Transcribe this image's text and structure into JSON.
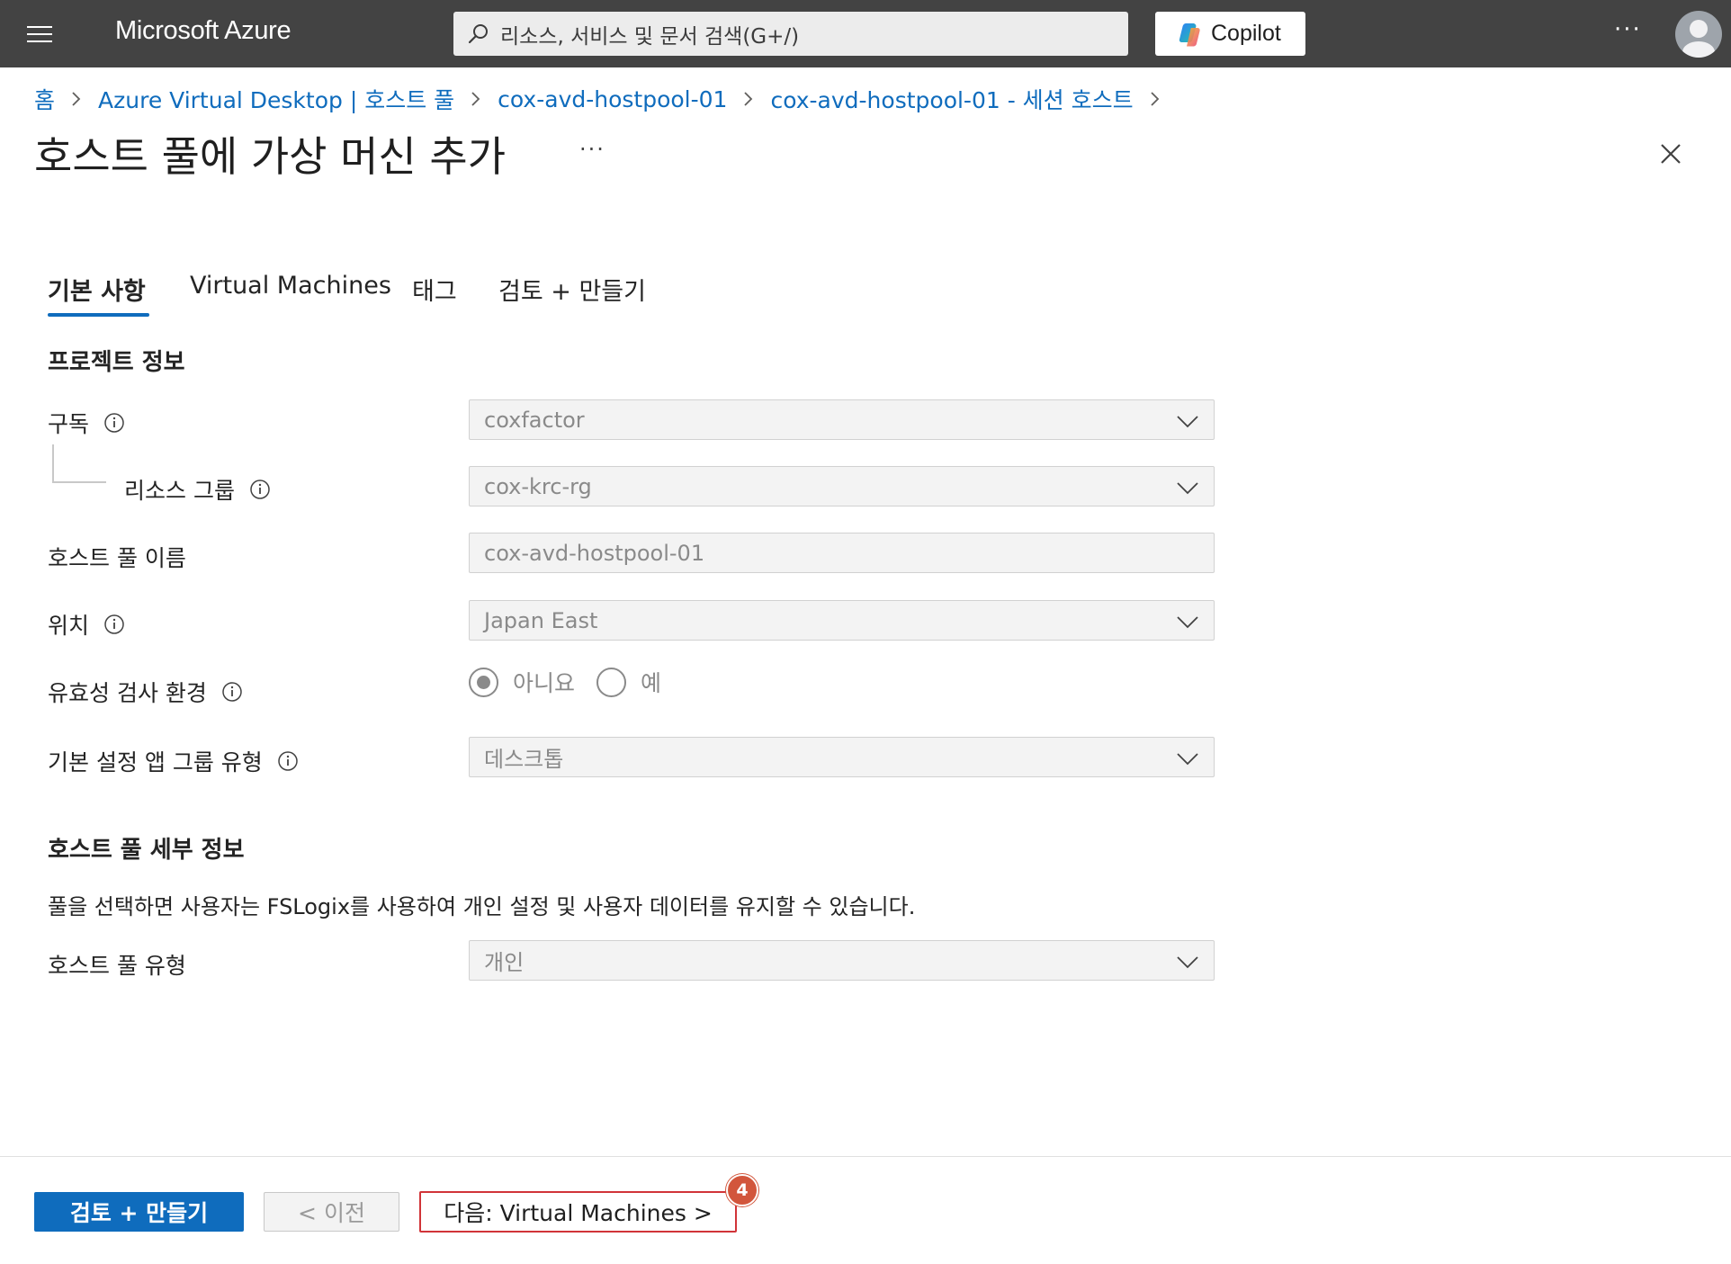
{
  "topbar": {
    "brand": "Microsoft Azure",
    "search_placeholder": "리소스, 서비스 및 문서 검색(G+/)",
    "copilot_label": "Copilot",
    "more": "···"
  },
  "breadcrumb": [
    "홈",
    "Azure Virtual Desktop | 호스트 풀",
    "cox-avd-hostpool-01",
    "cox-avd-hostpool-01 - 세션 호스트"
  ],
  "page": {
    "title": "호스트 풀에 가상 머신 추가",
    "title_more": "···"
  },
  "tabs": [
    "기본 사항",
    "Virtual Machines",
    "태그",
    "검토 + 만들기"
  ],
  "project": {
    "section_title": "프로젝트 정보",
    "subscription_label": "구독",
    "subscription_value": "coxfactor",
    "resource_group_label": "리소스 그룹",
    "resource_group_value": "cox-krc-rg",
    "host_pool_name_label": "호스트 풀 이름",
    "host_pool_name_value": "cox-avd-hostpool-01",
    "location_label": "위치",
    "location_value": "Japan East",
    "validation_label": "유효성 검사 환경",
    "validation_options": [
      "아니요",
      "예"
    ],
    "app_group_label": "기본 설정 앱 그룹 유형",
    "app_group_value": "데스크톱"
  },
  "details": {
    "section_title": "호스트 풀 세부 정보",
    "description": "풀을 선택하면 사용자는 FSLogix를 사용하여 개인 설정 및 사용자 데이터를 유지할 수 있습니다.",
    "type_label": "호스트 풀 유형",
    "type_value": "개인"
  },
  "footer": {
    "review_create": "검토 + 만들기",
    "previous": "< 이전",
    "next": "다음: Virtual Machines >",
    "badge": "4"
  },
  "colors": {
    "topbar": "#434343",
    "accent": "#0f6cbd",
    "highlight": "#d13438",
    "badge": "#d2563c"
  }
}
